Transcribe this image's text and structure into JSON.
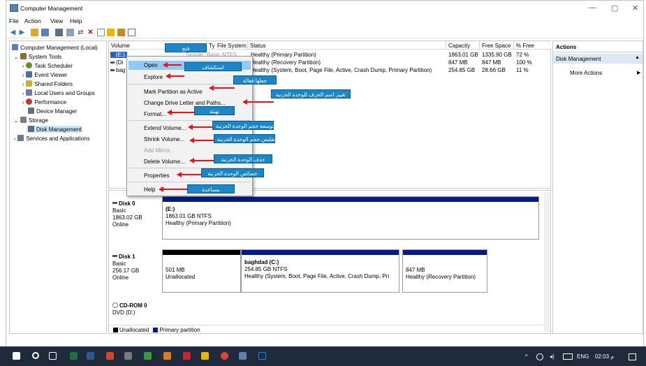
{
  "window": {
    "title": "Computer Management",
    "controls": [
      "—",
      "▢",
      "✕"
    ]
  },
  "menu": [
    "File",
    "Action",
    "View",
    "Help"
  ],
  "tree": {
    "items": [
      {
        "label": "Computer Management (Local)",
        "icon": "computer-icon",
        "color": "#5d7fb2"
      },
      {
        "label": "System Tools",
        "icon": "tools-icon",
        "color": "#8a6d3b"
      },
      {
        "label": "Task Scheduler",
        "icon": "clock-icon",
        "color": "#6b8e23"
      },
      {
        "label": "Event Viewer",
        "icon": "event-icon",
        "color": "#4a6fa5"
      },
      {
        "label": "Shared Folders",
        "icon": "folder-icon",
        "color": "#d9a92b"
      },
      {
        "label": "Local Users and Groups",
        "icon": "users-icon",
        "color": "#6a7ba2"
      },
      {
        "label": "Performance",
        "icon": "performance-icon",
        "color": "#c0392b"
      },
      {
        "label": "Device Manager",
        "icon": "device-icon",
        "color": "#5b6f86"
      },
      {
        "label": "Storage",
        "icon": "storage-icon",
        "color": "#7d7d7d"
      },
      {
        "label": "Disk Management",
        "icon": "disk-icon",
        "color": "#5b6f86"
      },
      {
        "label": "Services and Applications",
        "icon": "services-icon",
        "color": "#6b7a8f"
      }
    ]
  },
  "list": {
    "headers": [
      "Volume",
      "Layout",
      "Type",
      "File System",
      "Status",
      "Capacity",
      "Free Space",
      "% Free"
    ],
    "rows": [
      {
        "volume": "(E:)",
        "layout": "Simple",
        "type": "Basic",
        "fs": "NTFS",
        "status": "Healthy (Primary Partition)",
        "capacity": "1863.01 GB",
        "free": "1335.90 GB",
        "pct": "72 %"
      },
      {
        "volume": "(Di",
        "layout": "",
        "type": "",
        "fs": "",
        "status": "Healthy (Recovery Partition)",
        "capacity": "847 MB",
        "free": "847 MB",
        "pct": "100 %"
      },
      {
        "volume": "bag",
        "layout": "",
        "type": "",
        "fs": "",
        "status": "Healthy (System, Boot, Page File, Active, Crash Dump, Primary Partition)",
        "capacity": "254.85 GB",
        "free": "28.66 GB",
        "pct": "11 %"
      }
    ]
  },
  "context_menu": {
    "items": [
      "Open",
      "Explore",
      "Mark Partition as Active",
      "Change Drive Letter and Paths...",
      "Format...",
      "Extend Volume...",
      "Shrink Volume...",
      "Add Mirror...",
      "Delete Volume...",
      "Properties",
      "Help"
    ]
  },
  "callouts": [
    "فتح",
    "استكشاف",
    "جعلها فعالة",
    "تغيير اسم الحرف للوحدة الخزنية",
    "تهيئة",
    "توسعة حجم الوحدة الخزنية",
    "تقليص حجم الوحدة الخزنية",
    "حذف الوحدة الخزنية",
    "خصائص الوحدة الخزنية",
    "مساعدة"
  ],
  "disks": [
    {
      "name": "Disk 0",
      "type": "Basic",
      "size": "1863.02 GB",
      "state": "Online",
      "volumes": [
        {
          "title": "(E:)",
          "line2": "1863.01 GB NTFS",
          "line3": "Healthy (Primary Partition)"
        }
      ]
    },
    {
      "name": "Disk 1",
      "type": "Basic",
      "size": "256.17 GB",
      "state": "Online",
      "volumes": [
        {
          "title": "",
          "line2": "501 MB",
          "line3": "Unallocated"
        },
        {
          "title": "baghdad  (C:)",
          "line2": "254.85 GB NTFS",
          "line3": "Healthy (System, Boot, Page File, Active, Crash Dump, Pri"
        },
        {
          "title": "",
          "line2": "847 MB",
          "line3": "Healthy (Recovery Partition)"
        }
      ]
    },
    {
      "name": "CD-ROM 0",
      "type": "DVD (D:)",
      "size": "",
      "state": "",
      "volumes": []
    }
  ],
  "legend": [
    "Unallocated",
    "Primary partition"
  ],
  "actions": {
    "header": "Actions",
    "section": "Disk Management",
    "more": "More Actions"
  },
  "taskbar": {
    "lang": "ENG",
    "time": "02:03 م"
  },
  "colors": {
    "primary_partition": "#001a8c",
    "unallocated": "#000000",
    "callout": "#1c86c6",
    "arrow": "#e11111"
  }
}
